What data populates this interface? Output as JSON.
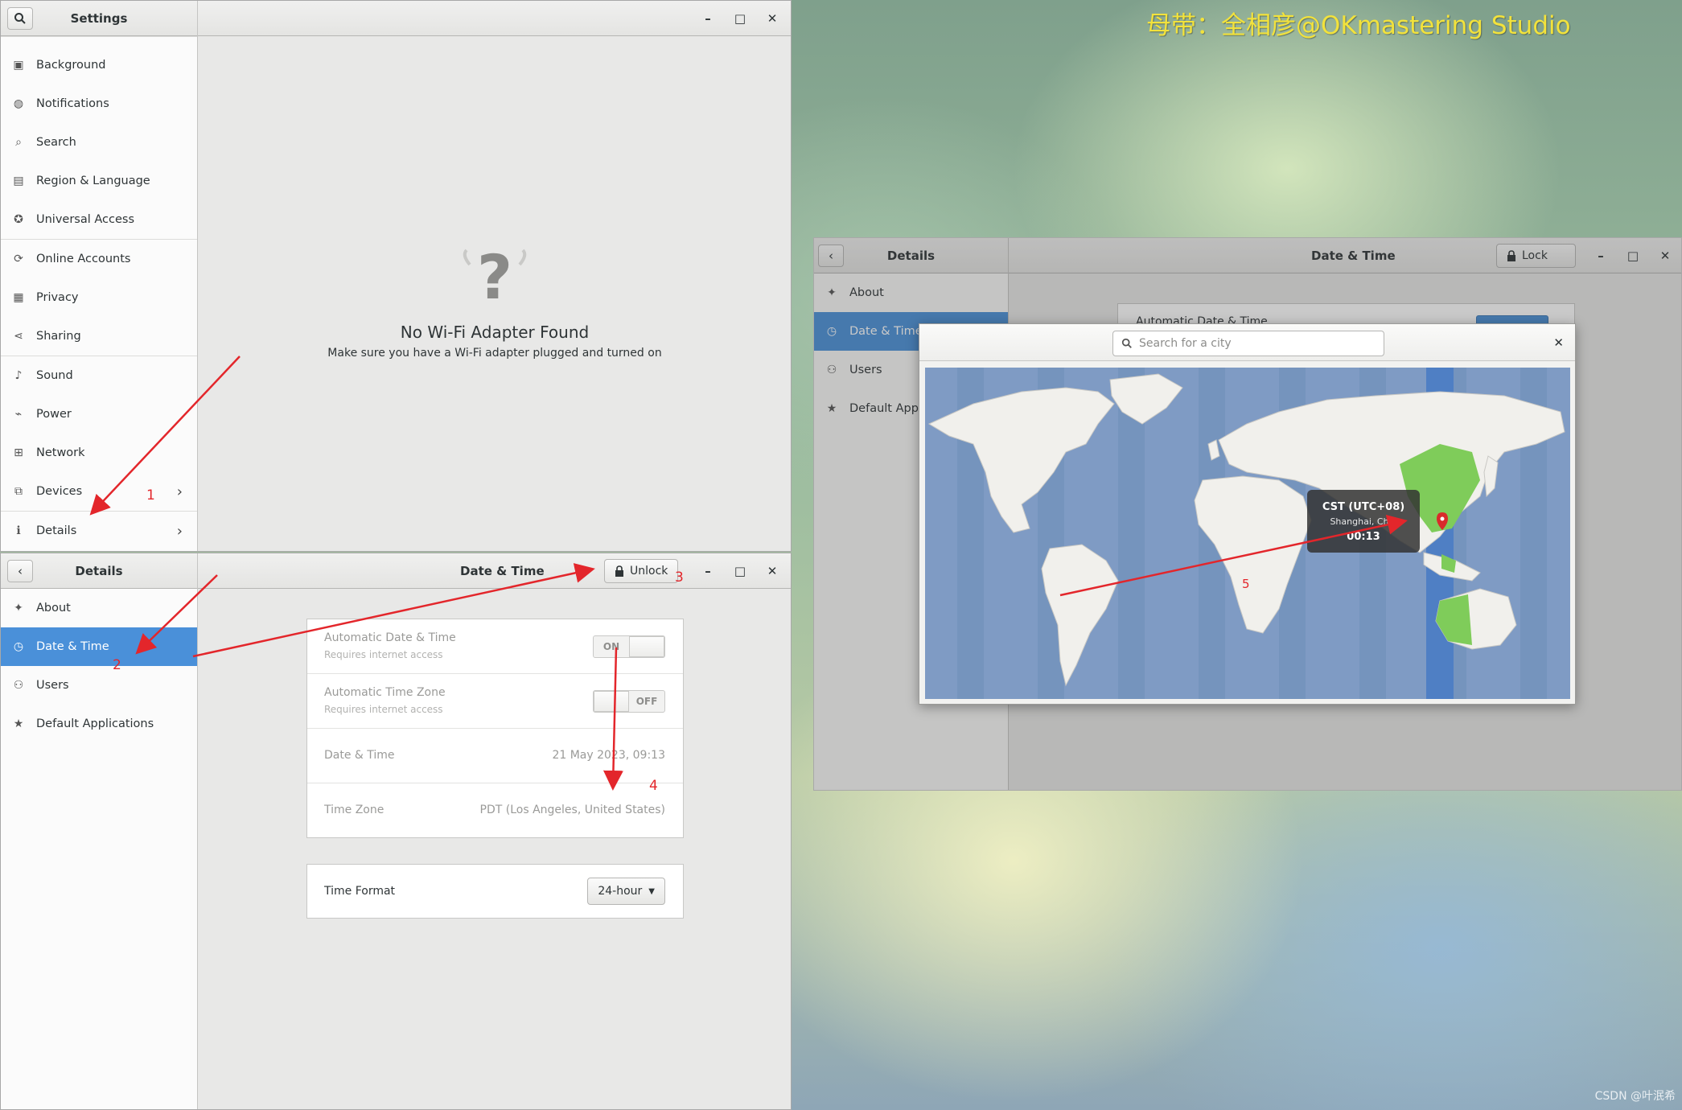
{
  "watermark": "母带：全相彦@OKmastering Studio",
  "corner_credit": "CSDN @叶泯希",
  "settings_window": {
    "title": "Settings",
    "sidebar_items": [
      {
        "label": "Background",
        "icon": "background-icon"
      },
      {
        "label": "Notifications",
        "icon": "notifications-icon"
      },
      {
        "label": "Search",
        "icon": "search-icon"
      },
      {
        "label": "Region & Language",
        "icon": "region-icon"
      },
      {
        "label": "Universal Access",
        "icon": "universal-access-icon"
      },
      {
        "label": "Online Accounts",
        "icon": "online-accounts-icon"
      },
      {
        "label": "Privacy",
        "icon": "privacy-icon"
      },
      {
        "label": "Sharing",
        "icon": "sharing-icon"
      },
      {
        "label": "Sound",
        "icon": "sound-icon"
      },
      {
        "label": "Power",
        "icon": "power-icon"
      },
      {
        "label": "Network",
        "icon": "network-icon"
      },
      {
        "label": "Devices",
        "icon": "devices-icon"
      },
      {
        "label": "Details",
        "icon": "details-icon"
      }
    ],
    "empty_state": {
      "title": "No Wi-Fi Adapter Found",
      "subtitle": "Make sure you have a Wi-Fi adapter plugged and turned on"
    }
  },
  "datetime_window": {
    "sidebar_title": "Details",
    "title": "Date & Time",
    "unlock_label": "Unlock",
    "sidebar_items": [
      {
        "label": "About",
        "icon": "about-icon"
      },
      {
        "label": "Date & Time",
        "icon": "clock-icon",
        "selected": true
      },
      {
        "label": "Users",
        "icon": "users-icon"
      },
      {
        "label": "Default Applications",
        "icon": "star-icon"
      }
    ],
    "auto_datetime": {
      "label": "Automatic Date & Time",
      "sub": "Requires internet access",
      "state": "ON"
    },
    "auto_timezone": {
      "label": "Automatic Time Zone",
      "sub": "Requires internet access",
      "state": "OFF"
    },
    "date_time": {
      "label": "Date & Time",
      "value": "21 May 2023, 09:13"
    },
    "time_zone": {
      "label": "Time Zone",
      "value": "PDT (Los Angeles, United States)"
    },
    "time_format": {
      "label": "Time Format",
      "value": "24-hour"
    }
  },
  "details_window_right": {
    "sidebar_title": "Details",
    "title": "Date & Time",
    "lock_label": "Lock",
    "sidebar_items": [
      {
        "label": "About",
        "icon": "about-icon"
      },
      {
        "label": "Date & Time",
        "icon": "clock-icon",
        "selected": true
      },
      {
        "label": "Users",
        "icon": "users-icon"
      },
      {
        "label": "Default Applic",
        "icon": "star-icon"
      }
    ],
    "behind_row_label": "Automatic Date & Time"
  },
  "timezone_dialog": {
    "search_placeholder": "Search for a city",
    "tooltip": {
      "zone": "CST (UTC+08)",
      "city": "Shanghai, Chin",
      "time": "00:13"
    }
  },
  "annotations": [
    "1",
    "2",
    "3",
    "4",
    "5"
  ],
  "colors": {
    "accent": "#4a90d9",
    "annotation": "#e3262b",
    "highlight_zone": "#7fcc5a",
    "watermark": "#f2e23c"
  }
}
